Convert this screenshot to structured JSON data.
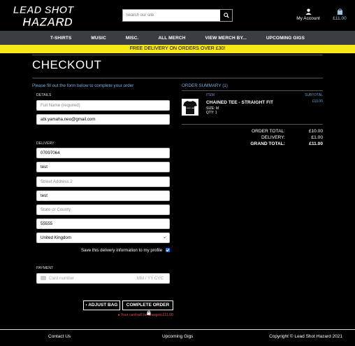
{
  "header": {
    "logo_line1": "LEAD SHOT",
    "logo_line2": "HAZARD",
    "search_placeholder": "Search our site",
    "account_label": "My Account",
    "cart_total": "£11.00"
  },
  "nav": {
    "items": [
      "T-SHIRTS",
      "MUSIC",
      "MISC.",
      "ALL MERCH",
      "VIEW MERCH BY...",
      "UPCOMING GIGS"
    ]
  },
  "banner": {
    "text": "FREE DELIVERY ON ORDERS OVER £30!"
  },
  "checkout": {
    "title": "CHECKOUT",
    "intro": "Please fill out the form below to complete your order",
    "details_label": "DETAILS",
    "full_name_placeholder": "Full Name (required)",
    "email_value": "abi.yamaha.neo@gmail.com",
    "delivery_label": "DELIVERY",
    "phone_value": "07097064",
    "street1_value": "test",
    "street2_placeholder": "Street Address 2",
    "town_value": "test",
    "county_placeholder": "State or County",
    "postcode_value": "55555",
    "country_value": "United Kingdom",
    "save_label": "Save this delivery information to my profile",
    "payment_label": "PAYMENT",
    "card_placeholder": "Card number",
    "card_date_placeholder": "MM / YY  CVC",
    "adjust_bag_label": "ADJUST BAG",
    "complete_order_label": "COMPLETE ORDER",
    "charge_note": "Your card will be charged £11.00"
  },
  "summary": {
    "title": "ORDER SUMMARY (1)",
    "col_item": "ITEM",
    "col_subtotal": "SUBTOTAL",
    "item_name": "CHAINED TEE - STRAIGHT FIT",
    "item_size": "SIZE: M",
    "item_qty": "QTY: 1",
    "item_subtotal": "£10.00",
    "thumb_text": "LEAD SHOT HAZARD",
    "order_total_label": "ORDER TOTAL:",
    "order_total_value": "£10.00",
    "delivery_label": "DELIVERY:",
    "delivery_value": "£1.00",
    "grand_total_label": "GRAND TOTAL:",
    "grand_total_value": "£11.00"
  },
  "footer": {
    "contact": "Contact Us",
    "gigs": "Upcoming Gigs",
    "copyright": "Copyright © Lead Shot Hazard 2021"
  },
  "colors": {
    "banner": "#f7e818",
    "nav": "#3a3e42",
    "accent_blue": "#7eaedc",
    "error_red": "#e24a4a"
  }
}
